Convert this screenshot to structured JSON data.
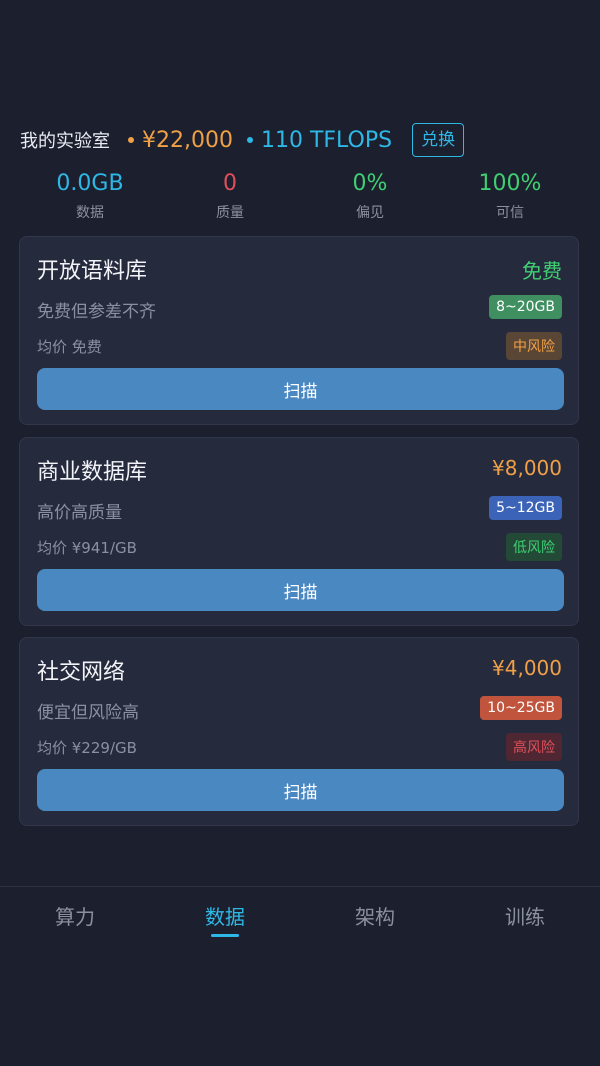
{
  "header": {
    "lab_title": "我的实验室",
    "money": "¥22,000",
    "compute": "110 TFLOPS",
    "exchange_label": "兑换"
  },
  "stats": [
    {
      "value": "0.0GB",
      "label": "数据",
      "color": "#2eb8e6"
    },
    {
      "value": "0",
      "label": "质量",
      "color": "#e0505a"
    },
    {
      "value": "0%",
      "label": "偏见",
      "color": "#3fcf72"
    },
    {
      "value": "100%",
      "label": "可信",
      "color": "#3fcf72"
    }
  ],
  "cards": [
    {
      "title": "开放语料库",
      "price": "免费",
      "price_color": "#3fcf72",
      "desc": "免费但参差不齐",
      "size": "8~20GB",
      "size_color": "#3f8f61",
      "avg": "均价 免费",
      "risk": "中风险",
      "risk_bg": "#5a4634",
      "risk_fg": "#f0a046",
      "scan_label": "扫描"
    },
    {
      "title": "商业数据库",
      "price": "¥8,000",
      "price_color": "#f0a046",
      "desc": "高价高质量",
      "size": "5~12GB",
      "size_color": "#3b63b8",
      "avg": "均价 ¥941/GB",
      "risk": "低风险",
      "risk_bg": "#234a37",
      "risk_fg": "#3fcf72",
      "scan_label": "扫描"
    },
    {
      "title": "社交网络",
      "price": "¥4,000",
      "price_color": "#f0a046",
      "desc": "便宜但风险高",
      "size": "10~25GB",
      "size_color": "#c0543d",
      "avg": "均价 ¥229/GB",
      "risk": "高风险",
      "risk_bg": "#4e2733",
      "risk_fg": "#e0505a",
      "scan_label": "扫描"
    }
  ],
  "nav": {
    "items": [
      {
        "label": "算力"
      },
      {
        "label": "数据",
        "active": true
      },
      {
        "label": "架构"
      },
      {
        "label": "训练"
      }
    ]
  }
}
